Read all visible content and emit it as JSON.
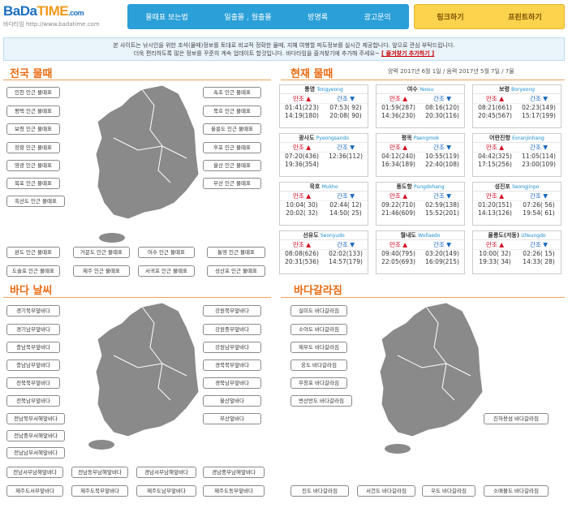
{
  "logo": {
    "brand_a": "BaDa",
    "brand_b": "TIME",
    "suffix": ".com",
    "sub": "바다타임 http://www.badatime.com"
  },
  "nav": [
    "물때표 보는법",
    "일출몰 , 월출몰",
    "방명록",
    "광고문의"
  ],
  "actions": [
    "링크하기",
    "프린트하기"
  ],
  "notice": {
    "line1": "본 사이트는 낚시인을 위한 조석(물때)정보를 토대로 비교적 정확한 물때, 지혜 여행할 파도정보를 실시간 제공합니다. 앞으로 관심 부탁드립니다.",
    "line2": "더욱 편리하도록 많은 정보를 꾸준히 계속 업데이트 할것입니다. 바다타임을 즐겨찾기에 추가해 주세요~",
    "link": "[ 즐겨찾기 추가하기 ]"
  },
  "sections": {
    "tide_map": "전국 물때",
    "current": "현재 물때",
    "weather": "바다 날씨",
    "sea_temp": "바다갈라짐"
  },
  "date_line": "양력 2017년 6월 1일 / 음력 2017년 5월 7일 / 7물",
  "tide_map_labels": [
    "인천 인근 물때표",
    "평택 인근 물때표",
    "보령 인근 물때표",
    "장항 인근 물때표",
    "영광 인근 물때표",
    "목포 인근 물때표",
    "흑산도 인근 물때표",
    "완도 인근 물때표",
    "도슬포 인근 물때표",
    "거문도 인근 물때표",
    "제주 인근 물때표",
    "여수 인근 물때표",
    "서귀포 인근 물때표",
    "통영 인근 물때표",
    "성산포 인근 물때표",
    "속초 인근 물때표",
    "묵호 인근 물때표",
    "울릉도 인근 물때표",
    "후포 인근 물때표",
    "울산 인근 물때표",
    "부산 인근 물때표"
  ],
  "weather_labels": [
    "경기북부앞바다",
    "경기남부앞바다",
    "충남북부앞바다",
    "충남남부앞바다",
    "전북북부앞바다",
    "전북남부앞바다",
    "전남북부서해앞바다",
    "전남중부서해앞바다",
    "전남남부서해앞바다",
    "전남서부남해앞바다",
    "전남동부남해앞바다",
    "경남서부남해앞바다",
    "경남중부남해앞바다",
    "제주도서부앞바다",
    "제주도북부앞바다",
    "제주도남부앞바다",
    "제주도동부앞바다",
    "강원북부앞바다",
    "강원중부앞바다",
    "강원남부앞바다",
    "경북북부앞바다",
    "경북남부앞바다",
    "울산앞바다",
    "부산앞바다"
  ],
  "sea_labels": [
    "실미도 바다갈라짐",
    "소야도 바다갈라짐",
    "제부도 바다갈라짐",
    "웅도 바다갈라짐",
    "무창포 바다갈라짐",
    "변산반도 바다갈라짐",
    "진도 바다갈라짐",
    "서건도 바다갈라짐",
    "우도 바다갈라짐",
    "소매물도 바다갈라짐",
    "진하용섬 바다갈라짐"
  ],
  "high": "만조 ▲",
  "low": "간조 ▼",
  "cards": [
    {
      "kr": "통영",
      "en": "Tongyeong",
      "h": [
        "01:41(223)",
        "14:19(180)"
      ],
      "l": [
        "07:53( 92)",
        "20:08( 90)"
      ]
    },
    {
      "kr": "여수",
      "en": "Yeosu",
      "h": [
        "01:59(287)",
        "14:36(230)"
      ],
      "l": [
        "08:16(120)",
        "20:30(116)"
      ]
    },
    {
      "kr": "보령",
      "en": "Boryeong",
      "h": [
        "08:21(661)",
        "20:45(567)"
      ],
      "l": [
        "02:23(149)",
        "15:17(199)"
      ]
    },
    {
      "kr": "광사도",
      "en": "Pyeongsando",
      "h": [
        "07:20(436)",
        "19:36(354)"
      ],
      "l": [
        "12:36(112)",
        ""
      ]
    },
    {
      "kr": "평목",
      "en": "Paengmok",
      "h": [
        "04:12(240)",
        "16:34(189)"
      ],
      "l": [
        "10:55(119)",
        "22:40(108)"
      ]
    },
    {
      "kr": "어란진항",
      "en": "Eoranjinhang",
      "h": [
        "04:42(325)",
        "17:15(256)"
      ],
      "l": [
        "11:05(114)",
        "23:00(109)"
      ]
    },
    {
      "kr": "묵호",
      "en": "Mukho",
      "h": [
        "10:04( 30)",
        "20:02( 32)"
      ],
      "l": [
        "02:44( 12)",
        "14:50( 25)"
      ]
    },
    {
      "kr": "풍도항",
      "en": "Pungdohang",
      "h": [
        "09:22(710)",
        "21:46(609)"
      ],
      "l": [
        "02:59(138)",
        "15:52(201)"
      ]
    },
    {
      "kr": "성진포",
      "en": "Seongjinpo",
      "h": [
        "01:20(151)",
        "14:13(126)"
      ],
      "l": [
        "07:26( 56)",
        "19:54( 61)"
      ]
    },
    {
      "kr": "선유도",
      "en": "Seonyudo",
      "h": [
        "08:08(626)",
        "20:31(536)"
      ],
      "l": [
        "02:02(133)",
        "14:57(179)"
      ]
    },
    {
      "kr": "월내도",
      "en": "Wollaedo",
      "h": [
        "09:40(795)",
        "22:05(693)"
      ],
      "l": [
        "03:20(149)",
        "16:09(215)"
      ]
    },
    {
      "kr": "울릉도(저동)",
      "en": "Ulleungdo",
      "h": [
        "10:00( 32)",
        "19:33( 34)"
      ],
      "l": [
        "02:26( 15)",
        "14:33( 28)"
      ]
    }
  ]
}
